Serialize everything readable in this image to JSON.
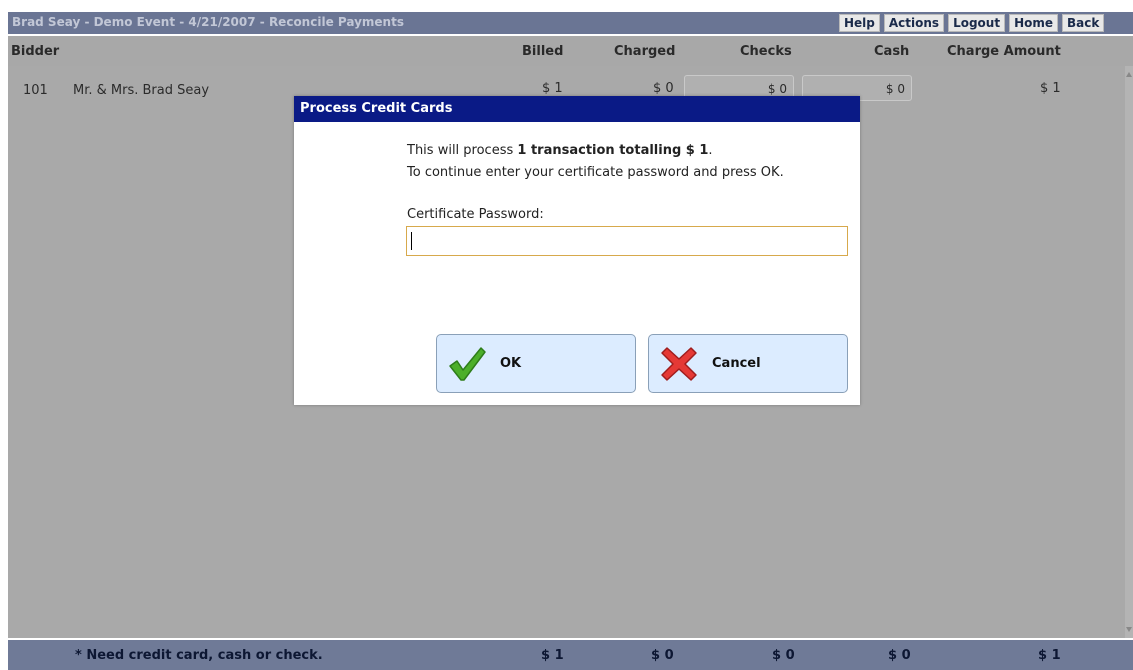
{
  "window": {
    "title": "Brad Seay - Demo Event - 4/21/2007 - Reconcile Payments",
    "nav": [
      "Help",
      "Actions",
      "Logout",
      "Home",
      "Back"
    ]
  },
  "table": {
    "columns": {
      "bidder": "Bidder",
      "billed": "Billed",
      "charged": "Charged",
      "checks": "Checks",
      "cash": "Cash",
      "charge_amount": "Charge Amount"
    },
    "rows": [
      {
        "number": "101",
        "name": "Mr. & Mrs. Brad Seay",
        "billed": "$ 1",
        "charged": "$ 0",
        "checks": "$ 0",
        "cash": "$ 0",
        "charge_amount": "$ 1"
      }
    ]
  },
  "footer": {
    "note": "* Need credit card, cash or check.",
    "billed_total": "$ 1",
    "charged_total": "$ 0",
    "checks_total": "$ 0",
    "cash_total": "$ 0",
    "charge_amount_total": "$ 1"
  },
  "dialog": {
    "title": "Process Credit Cards",
    "message_prefix": "This will process ",
    "message_bold": "1 transaction totalling $ 1",
    "message_suffix": ".",
    "message_line2": "To continue enter your certificate password and press OK.",
    "password_label": "Certificate Password:",
    "password_value": "",
    "ok_label": "OK",
    "cancel_label": "Cancel"
  },
  "icons": {
    "ok": "checkmark-icon",
    "cancel": "x-icon"
  },
  "colors": {
    "titlebar": "#6a7594",
    "dialog_titlebar": "#0a1a86",
    "button_bg": "#dcecff",
    "footer": "#6f7a97"
  }
}
